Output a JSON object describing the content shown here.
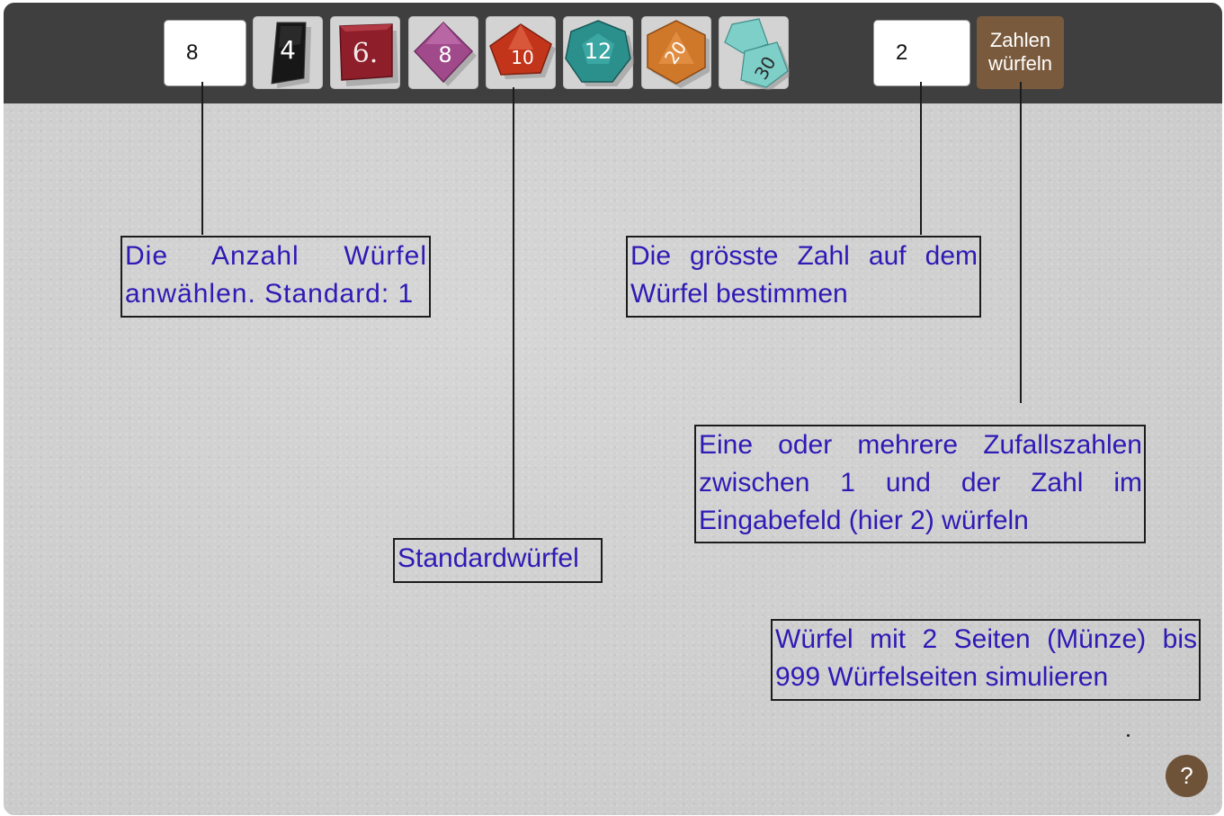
{
  "toolbar": {
    "dice_count_value": "8",
    "max_number_value": "2",
    "roll_button_label": "Zahlen würfeln",
    "dice": [
      {
        "label": "4",
        "icon": "d4-icon",
        "color": "#1a1a1a"
      },
      {
        "label": "6.",
        "icon": "d6-icon",
        "color": "#8e1f2a"
      },
      {
        "label": "8",
        "icon": "d8-icon",
        "color": "#a04a8c"
      },
      {
        "label": "10",
        "icon": "d10-icon",
        "color": "#c2351b"
      },
      {
        "label": "12",
        "icon": "d12-icon",
        "color": "#2b8f8c"
      },
      {
        "label": "20",
        "icon": "d20-icon",
        "color": "#d0782a"
      },
      {
        "label": "30",
        "icon": "d30-icon",
        "color": "#7fcfc9"
      }
    ]
  },
  "notes": {
    "dice_count": "Die Anzahl Würfel anwählen. Standard: 1",
    "max_number": "Die grösste Zahl auf dem Würfel bestimmen",
    "roll": "Eine oder mehrere Zufallszahlen zwischen 1 und der Zahl im Eingabefeld (hier 2) würfeln",
    "standard_dice": "Standardwürfel",
    "range": "Würfel mit 2 Seiten (Münze) bis 999 Würfelseiten simulieren"
  },
  "help": {
    "label": "?"
  },
  "colors": {
    "toolbar": "#3f3f3f",
    "roll_button": "#7a5a3d",
    "note_text": "#2e1ab5"
  }
}
